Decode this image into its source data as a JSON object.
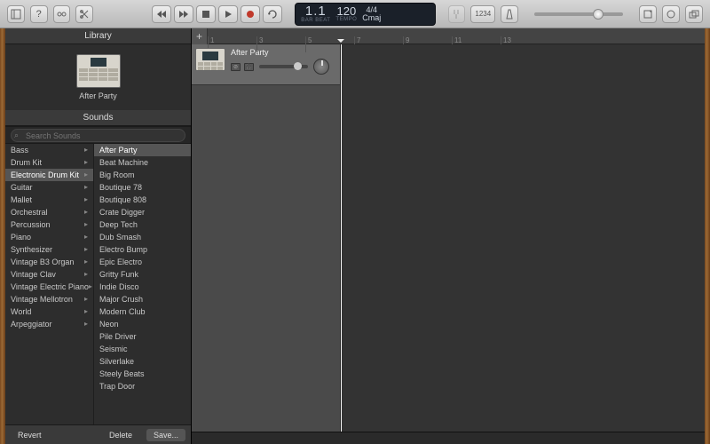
{
  "toolbar": {
    "library_toggle": "Library",
    "quick_help": "?",
    "lcd": {
      "position": "1.1",
      "pos_sub": "BAR  BEAT",
      "tempo": "120",
      "tempo_sub": "TEMPO",
      "sig": "4/4",
      "key": "Cmaj"
    },
    "countin": "1234",
    "master_vol_pct": 70
  },
  "library": {
    "title": "Library",
    "preview_name": "After Party",
    "sounds_header": "Sounds",
    "search_placeholder": "Search Sounds",
    "categories": [
      "Bass",
      "Drum Kit",
      "Electronic Drum Kit",
      "Guitar",
      "Mallet",
      "Orchestral",
      "Percussion",
      "Piano",
      "Synthesizer",
      "Vintage B3 Organ",
      "Vintage Clav",
      "Vintage Electric Piano",
      "Vintage Mellotron",
      "World",
      "Arpeggiator"
    ],
    "selected_category_index": 2,
    "presets": [
      "After Party",
      "Beat Machine",
      "Big Room",
      "Boutique 78",
      "Boutique 808",
      "Crate Digger",
      "Deep Tech",
      "Dub Smash",
      "Electro Bump",
      "Epic Electro",
      "Gritty Funk",
      "Indie Disco",
      "Major Crush",
      "Modern Club",
      "Neon",
      "Pile Driver",
      "Seismic",
      "Silverlake",
      "Steely Beats",
      "Trap Door"
    ],
    "selected_preset_index": 0,
    "footer": {
      "revert": "Revert",
      "delete": "Delete",
      "save": "Save..."
    }
  },
  "tracks": {
    "ruler_marks": [
      1,
      3,
      5,
      7,
      9,
      11,
      13
    ],
    "items": [
      {
        "name": "After Party",
        "vol_pct": 70
      }
    ],
    "playhead_bar": 1
  }
}
